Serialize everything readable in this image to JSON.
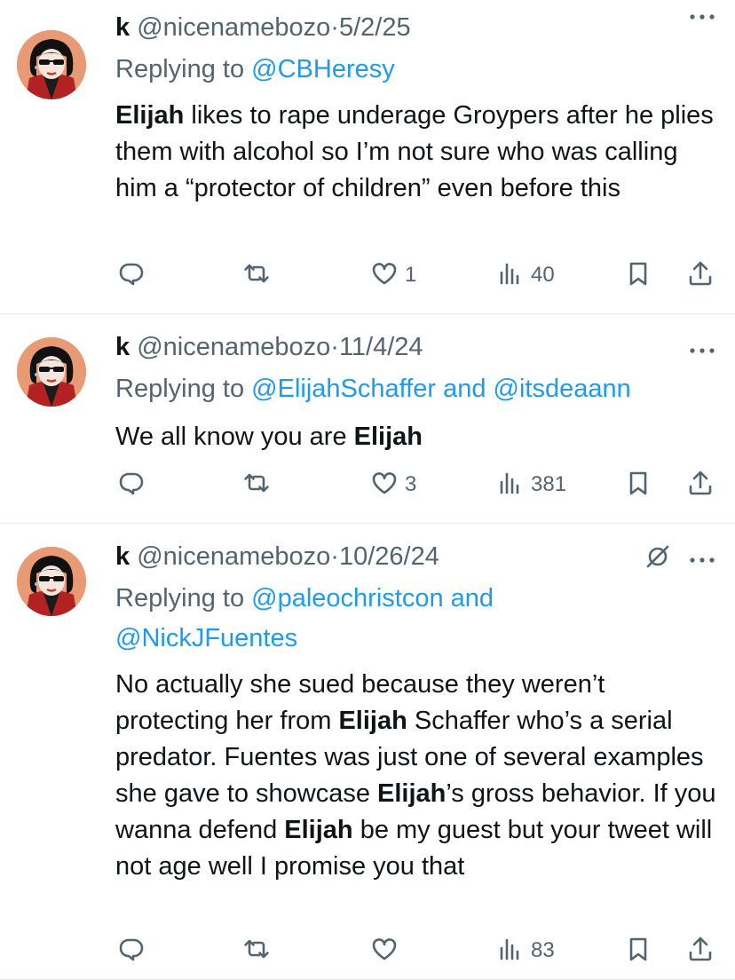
{
  "tweets": [
    {
      "name": "k",
      "handle": "@nicenamebozo",
      "separator": "·",
      "date": "5/2/25",
      "replying_prefix": "Replying to",
      "replying_to": [
        "@CBHeresy"
      ],
      "replying_joiner": "",
      "text_segments": [
        {
          "t": "Elijah",
          "bold": true
        },
        {
          "t": " likes to rape underage Groypers after he plies them with alcohol so I’m not sure who was calling him a “protector of children” even before this",
          "bold": false
        }
      ],
      "stats": {
        "replies": "",
        "reposts": "",
        "likes": "1",
        "views": "40"
      },
      "muted": false
    },
    {
      "name": "k",
      "handle": "@nicenamebozo",
      "separator": "·",
      "date": "11/4/24",
      "replying_prefix": "Replying to",
      "replying_to": [
        "@ElijahSchaffer",
        "@itsdeaann"
      ],
      "replying_joiner": "and",
      "text_segments": [
        {
          "t": "We all know you are ",
          "bold": false
        },
        {
          "t": "Elijah",
          "bold": true
        }
      ],
      "stats": {
        "replies": "",
        "reposts": "",
        "likes": "3",
        "views": "381"
      },
      "muted": false
    },
    {
      "name": "k",
      "handle": "@nicenamebozo",
      "separator": "·",
      "date": "10/26/24",
      "replying_prefix": "Replying to",
      "replying_to": [
        "@paleochristcon",
        "@NickJFuentes"
      ],
      "replying_joiner": "and",
      "text_segments": [
        {
          "t": "No actually she sued because they weren’t protecting her from ",
          "bold": false
        },
        {
          "t": "Elijah",
          "bold": true
        },
        {
          "t": " Schaffer who’s a serial predator. Fuentes was just one of several examples she gave to showcase ",
          "bold": false
        },
        {
          "t": "Elijah",
          "bold": true
        },
        {
          "t": "’s gross behavior. If you wanna defend ",
          "bold": false
        },
        {
          "t": "Elijah",
          "bold": true
        },
        {
          "t": " be my guest but your tweet will not age well I promise you that",
          "bold": false
        }
      ],
      "stats": {
        "replies": "",
        "reposts": "",
        "likes": "",
        "views": "83"
      },
      "muted": true
    }
  ],
  "icons": {
    "reply": "reply-icon",
    "repost": "repost-icon",
    "like": "heart-icon",
    "views": "views-icon",
    "bookmark": "bookmark-icon",
    "share": "share-icon",
    "more": "more-icon",
    "mute": "mute-icon"
  },
  "colors": {
    "text": "#0f1419",
    "secondary": "#536471",
    "link": "#1d9bf0",
    "divider": "#e6e6e6"
  }
}
